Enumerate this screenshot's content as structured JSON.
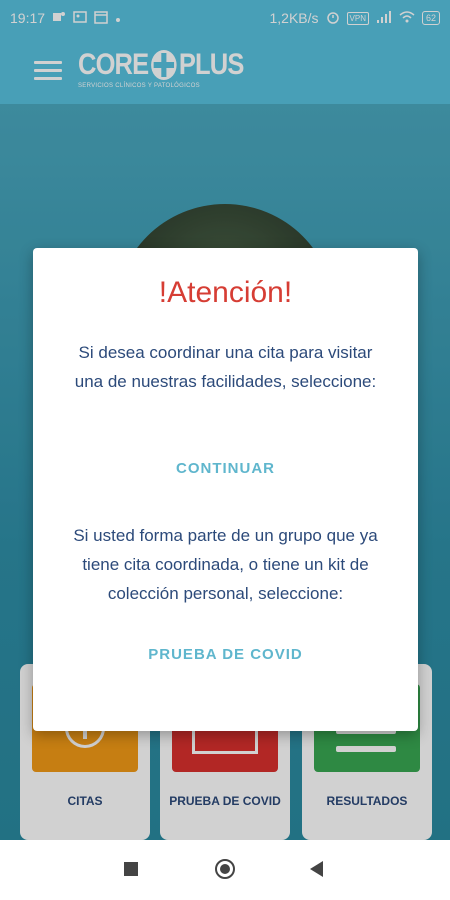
{
  "status_bar": {
    "time": "19:17",
    "left_icons": [
      "teams-icon",
      "image-icon",
      "calendar-icon",
      "dot-icon"
    ],
    "network_speed": "1,2KB/s",
    "vpn": "VPN",
    "battery": "62"
  },
  "app_bar": {
    "logo_left": "CORE",
    "logo_right": "PLUS",
    "logo_tagline": "SERVICIOS CLÍNICOS Y PATOLÓGICOS"
  },
  "tiles": [
    {
      "label": "CITAS"
    },
    {
      "label": "PRUEBA DE COVID"
    },
    {
      "label": "RESULTADOS"
    }
  ],
  "dialog": {
    "title": "!Atención!",
    "message_1": "Si desea coordinar una cita para visitar una de nuestras facilidades, seleccione:",
    "button_continue": "CONTINUAR",
    "message_2": "Si usted forma parte de un grupo que ya tiene cita coordinada, o tiene un kit de colección personal, seleccione:",
    "button_covid": "PRUEBA DE COVID"
  },
  "colors": {
    "header": "#58c3e0",
    "title_red": "#d63d34",
    "text_navy": "#2c4a7a",
    "button_blue": "#5fb6cd",
    "tile_orange": "#f29a17",
    "tile_red": "#d9302e",
    "tile_green": "#39a852"
  }
}
